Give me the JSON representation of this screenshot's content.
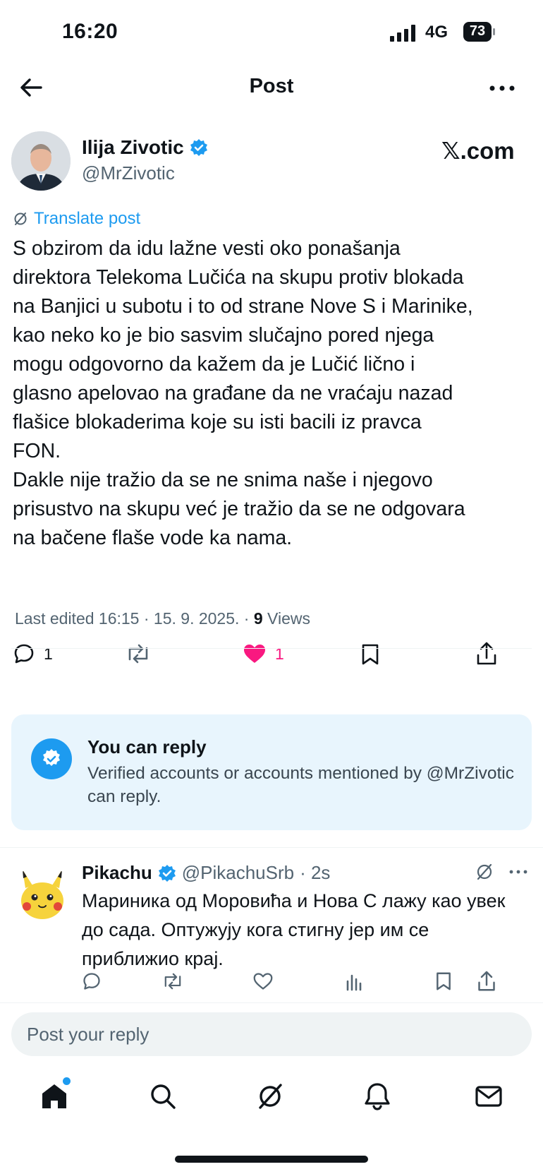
{
  "status_bar": {
    "time": "16:20",
    "network": "4G",
    "battery": "73"
  },
  "header": {
    "title": "Post",
    "back_icon": "arrow-left-icon",
    "more_icon": "ellipsis-icon"
  },
  "author": {
    "name": "Ilija Zivotic",
    "handle": "@MrZivotic",
    "verified": true,
    "brand": "𝕏.com"
  },
  "post": {
    "translate_label": "Translate post",
    "text": "S obzirom da idu lažne vesti oko ponašanja\ndirektora Telekoma Lučića na skupu protiv blokada\nna Banjici u subotu i to od strane Nove S i Marinike,\nkao neko ko je bio sasvim slučajno pored njega\nmogu odgovorno da kažem da je Lučić lično i\nglasno apelovao na građane da ne vraćaju nazad\nflašice blokaderima koje su isti bacili iz pravca\nFON.\nDakle nije tražio da se ne snima naše i njegovo\nprisustvo na skupu već je tražio da se ne odgovara\nna bačene flaše vode ka nama.",
    "meta_prefix": "Last edited 16:15 · 15. 9. 2025.  · ",
    "views_count": "9",
    "views_label": " Views",
    "actions": {
      "replies": "1",
      "likes": "1"
    },
    "accent_like": "#f91880"
  },
  "reply_restriction": {
    "title": "You can reply",
    "text": "Verified accounts or accounts mentioned by @MrZivotic can reply."
  },
  "reply": {
    "name": "Pikachu",
    "handle": "@PikachuSrb",
    "time": "· 2s",
    "text": "Мариника од Моровића и Нова С лажу као увек до сада. Оптужују кога стигну јер им се приближио крај."
  },
  "compose": {
    "placeholder": "Post your reply"
  },
  "colors": {
    "accent": "#1d9bf0",
    "text": "#0f1419",
    "muted": "#536471"
  }
}
